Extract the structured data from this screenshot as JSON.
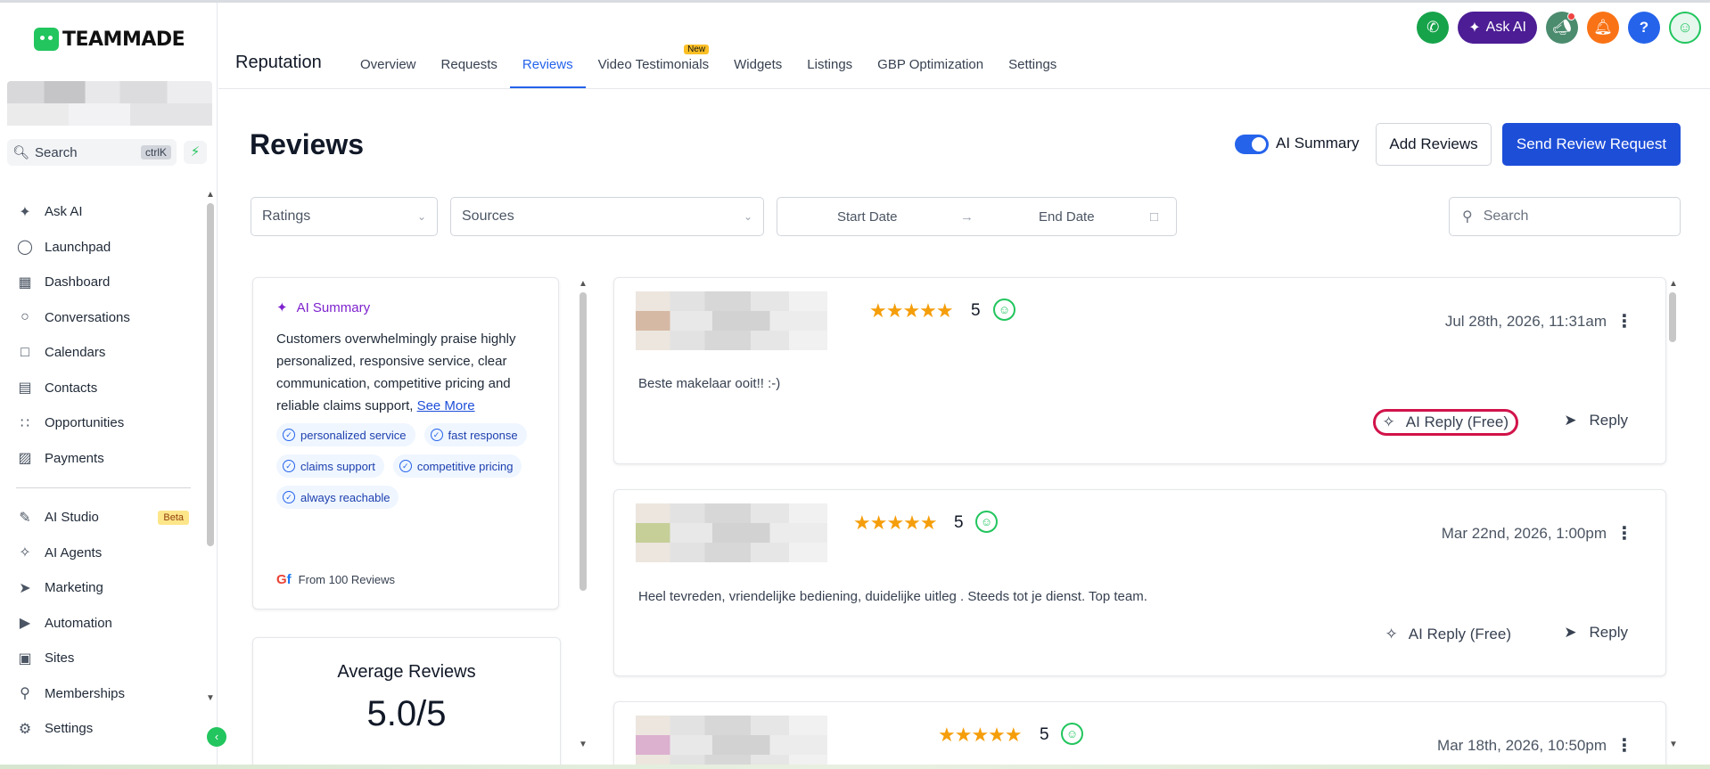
{
  "brand": {
    "name": "TEAMMADE"
  },
  "sidebar": {
    "search_placeholder": "Search",
    "search_shortcut": "ctrlK",
    "items": [
      {
        "label": "Ask AI",
        "icon": "sparkle-icon"
      },
      {
        "label": "Launchpad",
        "icon": "rocket-icon"
      },
      {
        "label": "Dashboard",
        "icon": "grid-icon"
      },
      {
        "label": "Conversations",
        "icon": "chat-bubble-icon"
      },
      {
        "label": "Calendars",
        "icon": "calendar-icon"
      },
      {
        "label": "Contacts",
        "icon": "contacts-icon"
      },
      {
        "label": "Opportunities",
        "icon": "pipeline-icon"
      },
      {
        "label": "Payments",
        "icon": "receipt-icon"
      }
    ],
    "items2": [
      {
        "label": "AI Studio",
        "icon": "ai-studio-icon",
        "badge": "Beta"
      },
      {
        "label": "AI Agents",
        "icon": "ai-agents-icon"
      },
      {
        "label": "Marketing",
        "icon": "send-icon"
      },
      {
        "label": "Automation",
        "icon": "automation-icon"
      },
      {
        "label": "Sites",
        "icon": "globe-icon"
      },
      {
        "label": "Memberships",
        "icon": "badge-icon"
      },
      {
        "label": "Settings",
        "icon": "gear-icon"
      }
    ]
  },
  "header": {
    "section": "Reputation",
    "tabs": [
      "Overview",
      "Requests",
      "Reviews",
      "Video Testimonials",
      "Widgets",
      "Listings",
      "GBP Optimization",
      "Settings"
    ],
    "active_tab": "Reviews",
    "new_badge": "New",
    "ask_ai": "Ask AI",
    "help": "?"
  },
  "page": {
    "title": "Reviews",
    "ai_summary_toggle": "AI Summary",
    "add_reviews": "Add Reviews",
    "send_request": "Send Review Request"
  },
  "filters": {
    "ratings": "Ratings",
    "sources": "Sources",
    "start_date": "Start Date",
    "end_date": "End Date",
    "search": "Search"
  },
  "summary": {
    "title": "AI Summary",
    "text": "Customers overwhelmingly praise highly personalized, responsive service, clear communication, competitive pricing and reliable claims support,",
    "see_more": "See More",
    "tags": [
      "personalized service",
      "fast response",
      "claims support",
      "competitive pricing",
      "always reachable"
    ],
    "from": "From 100 Reviews"
  },
  "average": {
    "label": "Average Reviews",
    "value": "5.0/5"
  },
  "reviews": [
    {
      "rating": "5",
      "date": "Jul 28th, 2026, 11:31am",
      "text": "Beste makelaar ooit!! :-)",
      "ai_reply": "AI Reply (Free)",
      "reply": "Reply"
    },
    {
      "rating": "5",
      "date": "Mar 22nd, 2026, 1:00pm",
      "text": "Heel tevreden, vriendelijke bediening, duidelijke uitleg . Steeds tot je dienst. Top team.",
      "ai_reply": "AI Reply (Free)",
      "reply": "Reply"
    },
    {
      "rating": "5",
      "date": "Mar 18th, 2026, 10:50pm"
    }
  ],
  "colors": {
    "accent": "#2563eb",
    "primary_button": "#1d4ed8",
    "star": "#f59e0b",
    "brand_green": "#22c55e",
    "highlight": "#d1134a"
  }
}
